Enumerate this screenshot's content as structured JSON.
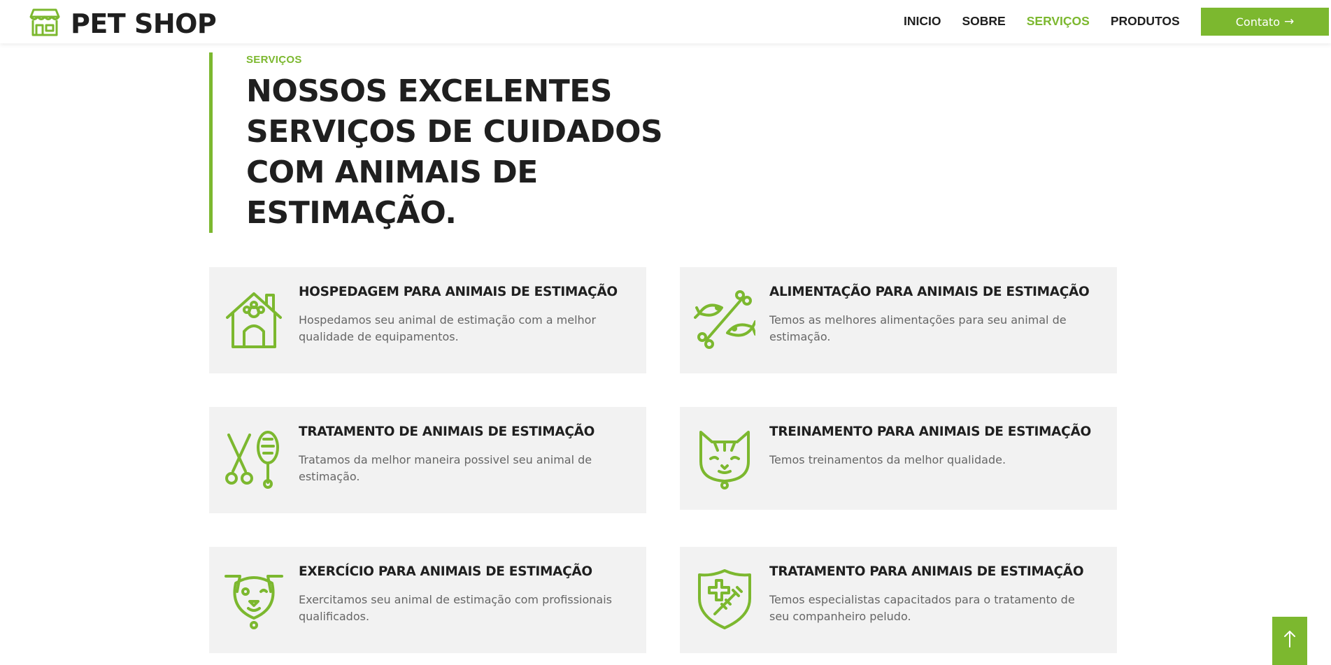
{
  "brand": {
    "name": "PET SHOP",
    "icon": "storefront-icon"
  },
  "nav": {
    "items": [
      {
        "label": "INICIO",
        "active": false
      },
      {
        "label": "SOBRE",
        "active": false
      },
      {
        "label": "SERVIÇOS",
        "active": true
      },
      {
        "label": "PRODUTOS",
        "active": false
      }
    ],
    "contact_label": "Contato",
    "contact_icon": "arrow-right-icon"
  },
  "section": {
    "label": "SERVIÇOS",
    "title": "NOSSOS EXCELENTES SERVIÇOS DE CUIDADOS COM ANIMAIS DE ESTIMAÇÃO."
  },
  "services": [
    {
      "title": "HOSPEDAGEM PARA ANIMAIS DE ESTIMAÇÃO",
      "description": "Hospedamos seu animal de estimação com a melhor qualidade de equipamentos.",
      "icon": "dog-house-icon"
    },
    {
      "title": "ALIMENTAÇÃO PARA ANIMAIS DE ESTIMAÇÃO",
      "description": "Temos as melhores alimentações para seu animal de estimação.",
      "icon": "bone-fish-icon"
    },
    {
      "title": "TRATAMENTO DE ANIMAIS DE ESTIMAÇÃO",
      "description": "Tratamos da melhor maneira possivel seu animal de estimação.",
      "icon": "scissors-brush-icon"
    },
    {
      "title": "TREINAMENTO PARA ANIMAIS DE ESTIMAÇÃO",
      "description": "Temos treinamentos da melhor qualidade.",
      "icon": "cat-face-icon"
    },
    {
      "title": "EXERCÍCIO PARA ANIMAIS DE ESTIMAÇÃO",
      "description": "Exercitamos seu animal de estimação com profissionais qualificados.",
      "icon": "dog-face-icon"
    },
    {
      "title": "TRATAMENTO PARA ANIMAIS DE ESTIMAÇÃO",
      "description": "Temos especialistas capacitados para o tratamento de seu companheiro peludo.",
      "icon": "shield-syringe-icon"
    }
  ],
  "scroll_top_icon": "arrow-up-icon",
  "colors": {
    "accent": "#7cb82f",
    "card_bg": "#f2f2f2",
    "text_dark": "#1f1f1f",
    "text_muted": "#666666"
  }
}
